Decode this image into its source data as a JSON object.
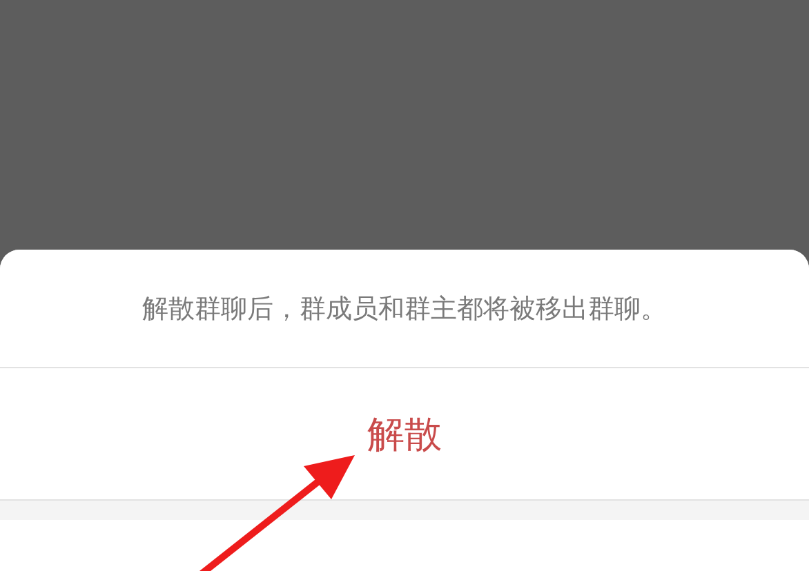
{
  "dialog": {
    "message": "解散群聊后，群成员和群主都将被移出群聊。",
    "actions": [
      {
        "kind": "danger",
        "label": "解散"
      }
    ]
  }
}
